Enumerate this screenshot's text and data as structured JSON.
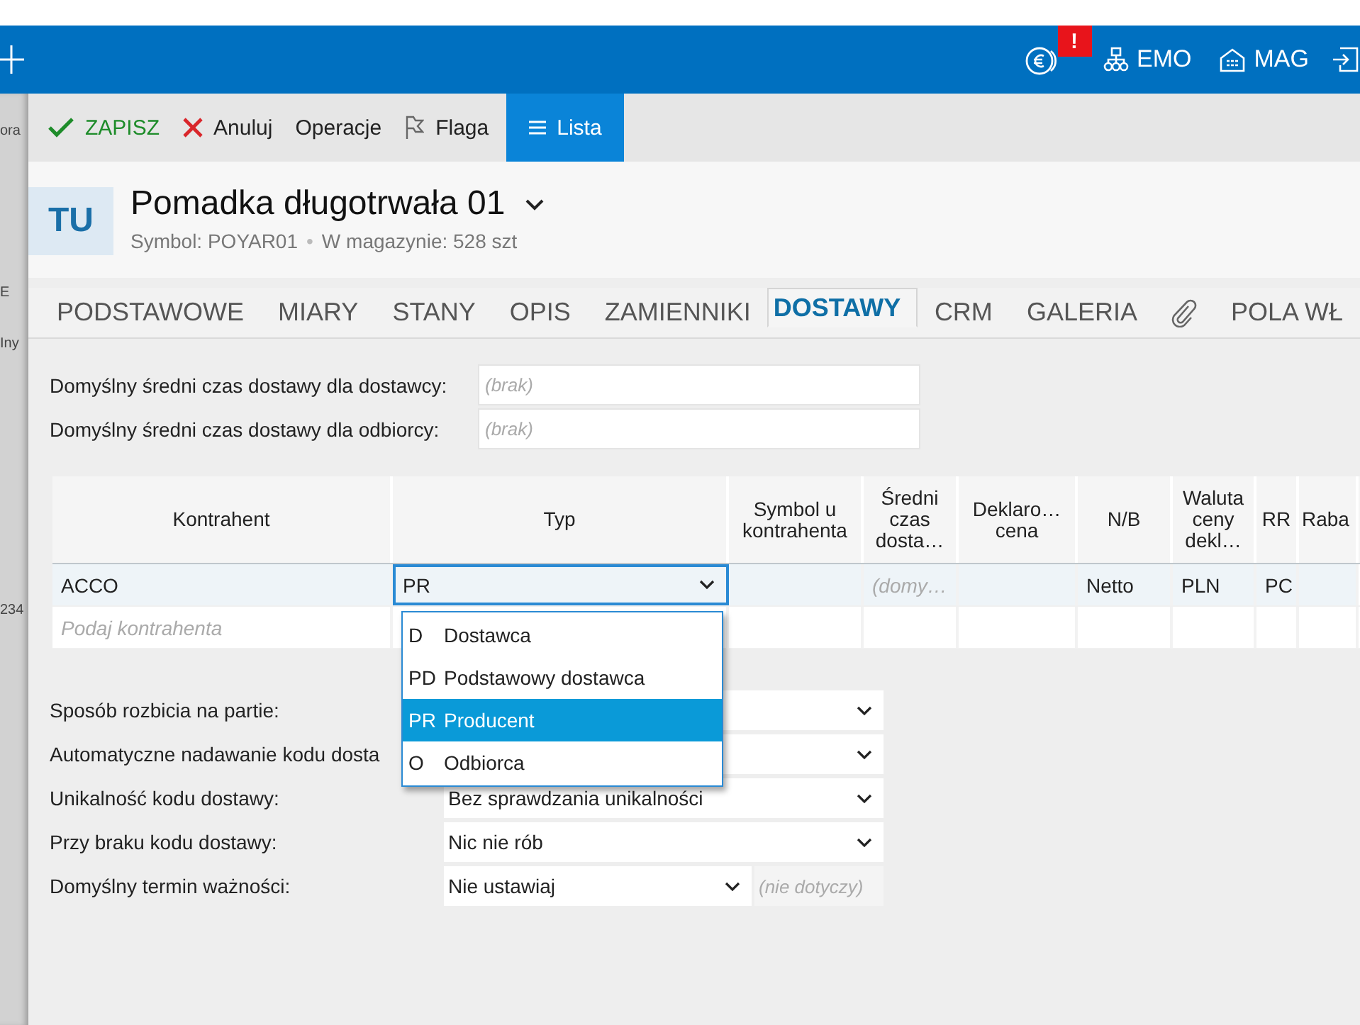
{
  "left_edge": [
    "ora",
    "E",
    "Iny",
    "234"
  ],
  "topbar": {
    "badge": "!",
    "items": [
      {
        "label": "EMO"
      },
      {
        "label": "MAG"
      }
    ]
  },
  "toolbar": [
    {
      "label": "ZAPISZ",
      "kind": "save",
      "active": false
    },
    {
      "label": "Anuluj",
      "kind": "cancel",
      "active": false
    },
    {
      "label": "Operacje",
      "kind": "plain",
      "active": false
    },
    {
      "label": "Flaga",
      "kind": "flag",
      "active": false
    },
    {
      "label": "Lista",
      "kind": "list",
      "active": true
    }
  ],
  "header": {
    "avatar": "TU",
    "title": "Pomadka długotrwała 01",
    "symbol": "Symbol: POYAR01",
    "separator": "•",
    "stock": "W magazynie: 528 szt"
  },
  "tabs": [
    {
      "kind": "text",
      "label": "PODSTAWOWE",
      "selected": false
    },
    {
      "kind": "text",
      "label": "MIARY",
      "selected": false
    },
    {
      "kind": "text",
      "label": "STANY",
      "selected": false
    },
    {
      "kind": "text",
      "label": "OPIS",
      "selected": false
    },
    {
      "kind": "text",
      "label": "ZAMIENNIKI",
      "selected": false
    },
    {
      "kind": "text",
      "label": "DOSTAWY",
      "selected": true
    },
    {
      "kind": "text",
      "label": "CRM",
      "selected": false
    },
    {
      "kind": "text",
      "label": "GALERIA",
      "selected": false
    },
    {
      "kind": "attachment",
      "selected": false
    },
    {
      "kind": "text",
      "label": "POLA WŁ",
      "selected": false
    }
  ],
  "default_times": [
    {
      "label": "Domyślny średni czas dostawy dla dostawcy:",
      "placeholder": "(brak)"
    },
    {
      "label": "Domyślny średni czas dostawy dla odbiorcy:",
      "placeholder": "(brak)"
    }
  ],
  "table": {
    "columns": [
      "Kontrahent",
      "Typ",
      "Symbol u kontrahenta",
      "Średni czas dosta…",
      "Deklaro… cena",
      "N/B",
      "Waluta ceny dekl…",
      "RR",
      "Raba"
    ],
    "rows": [
      {
        "selected": true,
        "cells": [
          {
            "kind": "text",
            "value": "ACCO"
          },
          {
            "kind": "select",
            "value": "PR"
          },
          {
            "kind": "empty"
          },
          {
            "kind": "placeholder",
            "value": "(domy…"
          },
          {
            "kind": "empty"
          },
          {
            "kind": "text",
            "value": "Netto"
          },
          {
            "kind": "text",
            "value": "PLN"
          },
          {
            "kind": "text",
            "value": "PC"
          },
          {
            "kind": "empty"
          }
        ]
      },
      {
        "selected": false,
        "cells": [
          {
            "kind": "placeholder",
            "value": "Podaj kontrahenta"
          },
          {
            "kind": "empty"
          },
          {
            "kind": "empty"
          },
          {
            "kind": "empty"
          },
          {
            "kind": "empty"
          },
          {
            "kind": "empty"
          },
          {
            "kind": "empty"
          },
          {
            "kind": "empty"
          },
          {
            "kind": "empty"
          }
        ]
      }
    ]
  },
  "dropdown": {
    "options": [
      {
        "code": "D",
        "label": "Dostawca",
        "selected": false
      },
      {
        "code": "PD",
        "label": "Podstawowy dostawca",
        "selected": false
      },
      {
        "code": "PR",
        "label": "Producent",
        "selected": true
      },
      {
        "code": "O",
        "label": "Odbiorca",
        "selected": false
      }
    ]
  },
  "settings": [
    {
      "label": "Sposób rozbicia na partie:"
    },
    {
      "label": "Automatyczne nadawanie kodu dosta"
    },
    {
      "label": "Unikalność kodu dostawy:",
      "value": "Bez sprawdzania unikalności"
    },
    {
      "label": "Przy braku kodu dostawy:",
      "value": "Nic nie rób"
    },
    {
      "label": "Domyślny termin ważności:",
      "value": "Nie ustawiaj",
      "note": "(nie dotyczy)"
    }
  ]
}
